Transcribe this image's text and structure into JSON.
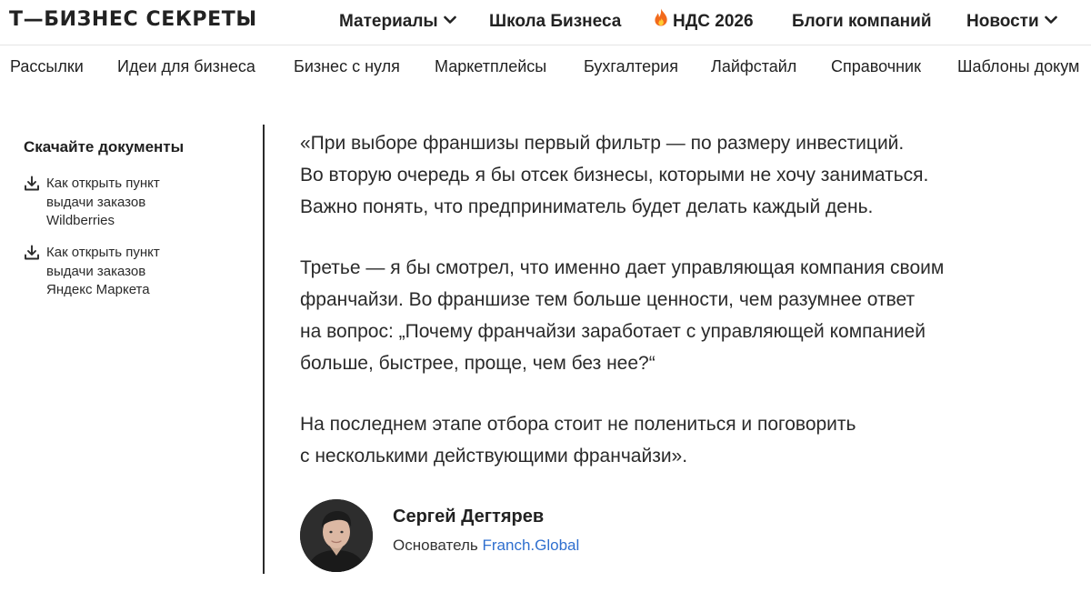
{
  "header": {
    "logo": "Т—БИЗНЕС СЕКРЕТЫ",
    "nav": [
      {
        "label": "Материалы",
        "has_dropdown": true
      },
      {
        "label": "Школа Бизнеса",
        "has_dropdown": false
      },
      {
        "label": "НДС 2026",
        "icon": "fire-icon",
        "has_dropdown": false
      },
      {
        "label": "Блоги компаний",
        "has_dropdown": false
      },
      {
        "label": "Новости",
        "has_dropdown": true
      }
    ]
  },
  "subnav": {
    "items": [
      "Рассылки",
      "Идеи для бизнеса",
      "Бизнес с нуля",
      "Маркетплейсы",
      "Бухгалтерия",
      "Лайфстайл",
      "Справочник",
      "Шаблоны докум"
    ]
  },
  "sidebar": {
    "title": "Скачайте документы",
    "links": [
      {
        "lines": [
          "Как открыть пункт",
          "выдачи заказов",
          "Wildberries"
        ],
        "icon": "download-icon"
      },
      {
        "lines": [
          "Как открыть пункт",
          "выдачи заказов",
          "Яндекс Маркета"
        ],
        "icon": "download-icon"
      }
    ]
  },
  "quote": {
    "paragraphs": [
      [
        "«При выборе франшизы первый фильтр — по размеру инвестиций.",
        "Во вторую очередь я бы отсек бизнесы, которыми не хочу заниматься.",
        "Важно понять, что предприниматель будет делать каждый день."
      ],
      [
        "Третье — я бы смотрел, что именно дает управляющая компания своим",
        "франчайзи. Во франшизе тем больше ценности, чем разумнее ответ",
        "на вопрос: „Почему франчайзи заработает с управляющей компанией",
        "больше, быстрее, проще, чем без нее?“"
      ],
      [
        "На последнем этапе отбора стоит не полениться и поговорить",
        "с несколькими действующими франчайзи»."
      ]
    ]
  },
  "author": {
    "name": "Сергей Дегтярев",
    "role_prefix": "Основатель",
    "company": "Franch.Global"
  },
  "colors": {
    "text": "#2a2a2a",
    "link": "#2f6fcf",
    "divider": "#2b2b2b",
    "fire": "#f26a1b"
  }
}
